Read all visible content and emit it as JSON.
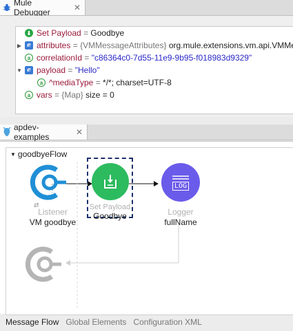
{
  "debugger": {
    "tab_title": "Mule Debugger",
    "rows": [
      {
        "name": "Set Payload",
        "eq": "=",
        "value": "Goodbye",
        "icon": "check-circle-icon"
      },
      {
        "name": "attributes",
        "eq": "=",
        "type": "{VMMessageAttributes}",
        "value": "org.mule.extensions.vm.api.VMMe",
        "icon": "e-icon"
      },
      {
        "name": "correlationId",
        "eq": "=",
        "value": "\"c86364c0-7d55-11e9-9b95-f018983d9329\"",
        "icon": "a-icon"
      },
      {
        "name": "payload",
        "eq": "=",
        "value": "\"Hello\"",
        "icon": "e-icon"
      },
      {
        "name": "^mediaType",
        "eq": "=",
        "value": "*/*; charset=UTF-8",
        "icon": "a-icon"
      },
      {
        "name": "vars",
        "eq": "=",
        "type": "{Map}",
        "value": "size = 0",
        "icon": "a-icon"
      }
    ]
  },
  "editor": {
    "tab_title": "apdev-examples",
    "flow_name": "goodbyeFlow",
    "components": {
      "listener": {
        "type": "Listener",
        "name": "VM goodbye"
      },
      "set_payload": {
        "type": "Set Payload",
        "name": "Goodbye"
      },
      "logger": {
        "type": "Logger",
        "name": "fullName",
        "icon_text": "LOG"
      }
    },
    "bottom_tabs": [
      "Message Flow",
      "Global Elements",
      "Configuration XML"
    ]
  },
  "colors": {
    "accent_blue": "#1f8fd6",
    "set_payload_green": "#2dbb5f",
    "logger_purple": "#6b5bea",
    "value_blue": "#2a28c8",
    "key_red": "#9a1a3a"
  }
}
